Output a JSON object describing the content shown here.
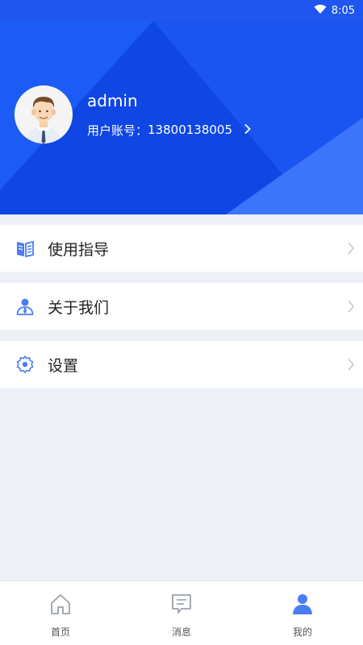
{
  "status_bar": {
    "time": "8:05",
    "wifi_icon": "wifi-icon"
  },
  "profile": {
    "username": "admin",
    "account_label": "用户账号：",
    "account_number": "13800138005",
    "avatar_icon": "user-avatar-icon"
  },
  "menu": [
    {
      "label": "使用指导",
      "icon": "guide-book-icon"
    },
    {
      "label": "关于我们",
      "icon": "person-tie-icon"
    },
    {
      "label": "设置",
      "icon": "gear-icon"
    }
  ],
  "tabbar": {
    "tabs": [
      {
        "label": "首页",
        "icon": "home-icon",
        "active": false
      },
      {
        "label": "消息",
        "icon": "message-icon",
        "active": false
      },
      {
        "label": "我的",
        "icon": "person-icon",
        "active": true
      }
    ]
  },
  "colors": {
    "header_blue": "#1650ef",
    "accent": "#4a7cf6",
    "background": "#edf1f5"
  }
}
